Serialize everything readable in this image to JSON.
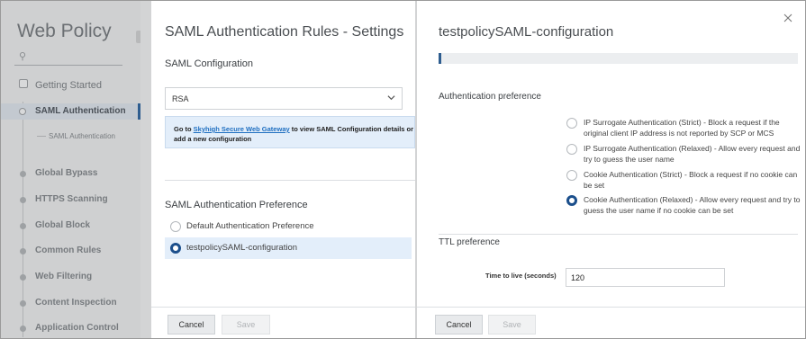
{
  "nav": {
    "title": "Web Policy",
    "search_icon": "search-icon",
    "items": [
      {
        "label": "Getting Started",
        "marker": "checkbox"
      },
      {
        "label": "SAML Authentication",
        "marker": "ring",
        "active": true
      },
      {
        "label": "Global Bypass",
        "marker": "dot"
      },
      {
        "label": "HTTPS Scanning",
        "marker": "dot"
      },
      {
        "label": "Global Block",
        "marker": "dot"
      },
      {
        "label": "Common Rules",
        "marker": "dot"
      },
      {
        "label": "Web Filtering",
        "marker": "dot"
      },
      {
        "label": "Content Inspection",
        "marker": "dot"
      },
      {
        "label": "Application Control",
        "marker": "dot"
      }
    ],
    "sub_item": "SAML Authentication"
  },
  "middle": {
    "title": "SAML Authentication Rules - Settings",
    "config_heading": "SAML Configuration",
    "select_value": "RSA",
    "info_prefix": "Go to ",
    "info_link": "Skyhigh Secure Web Gateway",
    "info_suffix": " to view SAML Configuration details or add a new configuration",
    "pref_heading": "SAML Authentication Preference",
    "options": [
      {
        "label": "Default Authentication Preference",
        "selected": false
      },
      {
        "label": "testpolicySAML-configuration",
        "selected": true
      }
    ],
    "cancel_label": "Cancel",
    "save_label": "Save"
  },
  "right": {
    "title": "testpolicySAML-configuration",
    "progress_fraction": 0.008,
    "auth_heading": "Authentication preference",
    "auth_options": [
      {
        "label": "IP Surrogate Authentication (Strict) - Block a request if the original client IP address is not reported by SCP or MCS",
        "selected": false
      },
      {
        "label": "IP Surrogate Authentication (Relaxed) - Allow every request and try to guess the user name",
        "selected": false
      },
      {
        "label": "Cookie Authentication (Strict) - Block a request if no cookie can be set",
        "selected": false
      },
      {
        "label": "Cookie Authentication (Relaxed) - Allow every request and try to guess the user name if no cookie can be set",
        "selected": true
      }
    ],
    "ttl_heading": "TTL preference",
    "ttl_label": "Time to live (seconds)",
    "ttl_value": "120",
    "cancel_label": "Cancel",
    "save_label": "Save",
    "close_icon": "close-icon"
  },
  "colors": {
    "accent": "#1b4f8c",
    "selection_bg": "#e3eefa",
    "link": "#1f6fc1"
  }
}
